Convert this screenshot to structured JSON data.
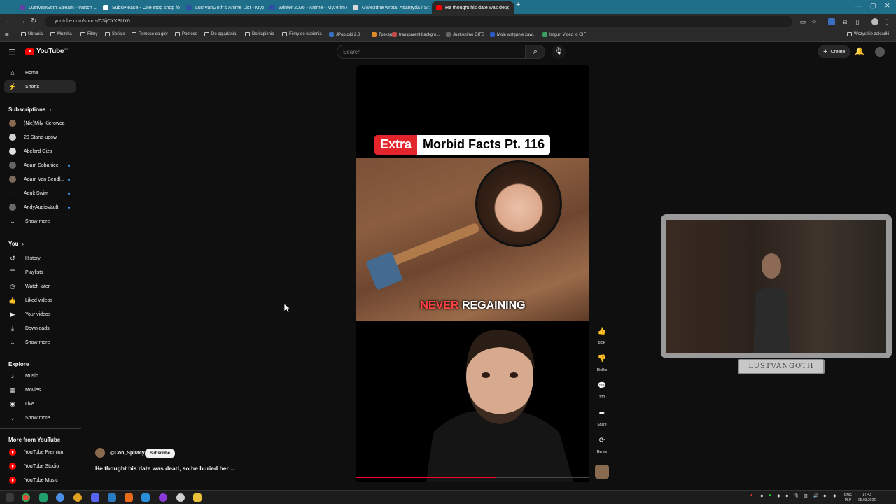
{
  "browser": {
    "tabs": [
      {
        "label": "LustVanGoth Stream - Watch L",
        "color": "#6441a5"
      },
      {
        "label": "SubsPlease - One stop shop fo",
        "color": "#ffffff"
      },
      {
        "label": "LustVanGoth's Anime List - My",
        "color": "#2e51a2"
      },
      {
        "label": "Winter 2026 - Anime - MyAnim",
        "color": "#2e51a2"
      },
      {
        "label": "Gwiezdne wrota: Atlantyda / St",
        "color": "#d8d8d8"
      },
      {
        "label": "He thought his date was de",
        "color": "#ff0000"
      }
    ],
    "new_tab": "+",
    "url": "youtube.com/shorts/C3ijCYXBUY0",
    "bookmarks": [
      "Ubrania",
      "Muzyka",
      "Filmy",
      "Seriale",
      "Pomoce do gier",
      "Pomoce",
      "Do oglądania",
      "Do kupienia",
      "Filmy do kupienia",
      "JPopuski 2.0",
      "Трекер",
      "transparent backgro...",
      "Just Anime GIFS",
      "Moje wstępnie zaw...",
      "Imgur: Video to GIF"
    ],
    "bookmarks_right": "Wszystkie zakładki"
  },
  "yt": {
    "logo": "YouTube",
    "region": "PL",
    "search_placeholder": "Search",
    "create": "Create"
  },
  "sidebar": {
    "main": [
      {
        "label": "Home",
        "icon": "home-icon",
        "glyph": "⌂"
      },
      {
        "label": "Shorts",
        "icon": "shorts-icon",
        "glyph": "⚡"
      }
    ],
    "subscriptions_title": "Subscriptions",
    "subscriptions": [
      {
        "label": "(Nie)Miły Kierowca",
        "color": "#8a6a4e",
        "live": false
      },
      {
        "label": "20 Stand-upów",
        "color": "#cfcfcf",
        "live": false
      },
      {
        "label": "Abelard Giza",
        "color": "#e0e0e0",
        "live": false
      },
      {
        "label": "Adam Sobaniec",
        "color": "#666666",
        "live": true
      },
      {
        "label": "Adam Van Bendl...",
        "color": "#7a6a5a",
        "live": true
      },
      {
        "label": "Adult Swim",
        "color": "#111111",
        "live": true
      },
      {
        "label": "AndyAudioVault",
        "color": "#6a6a6a",
        "live": true
      }
    ],
    "show_more": "Show more",
    "you_title": "You",
    "you": [
      {
        "label": "History",
        "glyph": "↺"
      },
      {
        "label": "Playlists",
        "glyph": "☰"
      },
      {
        "label": "Watch later",
        "glyph": "◷"
      },
      {
        "label": "Liked videos",
        "glyph": "👍"
      },
      {
        "label": "Your videos",
        "glyph": "▶"
      },
      {
        "label": "Downloads",
        "glyph": "⤓"
      }
    ],
    "explore_title": "Explore",
    "explore": [
      {
        "label": "Music",
        "glyph": "♪"
      },
      {
        "label": "Movies",
        "glyph": "▦"
      },
      {
        "label": "Live",
        "glyph": "◉"
      }
    ],
    "more_title": "More from YouTube",
    "more": [
      {
        "label": "YouTube Premium"
      },
      {
        "label": "YouTube Studio"
      },
      {
        "label": "YouTube Music"
      }
    ]
  },
  "short": {
    "badge": "Extra",
    "title": "Morbid Facts Pt. 116",
    "caption_red": "NEVER",
    "caption_white": " REGAINING",
    "progress": 0.6,
    "channel": "@Con_Spiracy",
    "subscribe": "Subscribe",
    "video_title": "He thought his date was dead, so he buried her ..."
  },
  "actions": [
    {
      "name": "like",
      "glyph": "👍",
      "label": "8.5K"
    },
    {
      "name": "dislike",
      "glyph": "👎",
      "label": "Dislike"
    },
    {
      "name": "comments",
      "glyph": "💬",
      "label": "370"
    },
    {
      "name": "share",
      "glyph": "➦",
      "label": "Share"
    },
    {
      "name": "remix",
      "glyph": "⟳",
      "label": "Remix"
    }
  ],
  "overlay": {
    "streamer_name": "LUSTVANGOTH"
  },
  "taskbar": {
    "lang": "ENG",
    "layout": "PLP",
    "time": "17:43",
    "date": "05.03.2026"
  }
}
